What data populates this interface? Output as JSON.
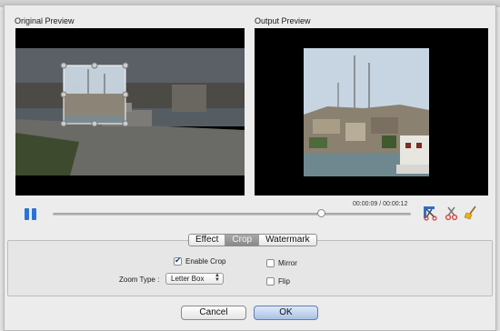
{
  "previews": {
    "original_label": "Original Preview",
    "output_label": "Output Preview"
  },
  "player": {
    "time": "00:00:09 / 00:00:12",
    "progress": 0.75
  },
  "tabs": [
    {
      "label": "Effect",
      "active": false
    },
    {
      "label": "Crop",
      "active": true
    },
    {
      "label": "Watermark",
      "active": false
    }
  ],
  "crop": {
    "enable_crop_label": "Enable Crop",
    "enable_crop_checked": true,
    "mirror_label": "Mirror",
    "mirror_checked": false,
    "flip_label": "Flip",
    "flip_checked": false,
    "zoom_type_label": "Zoom Type :",
    "zoom_type_value": "Letter Box"
  },
  "buttons": {
    "cancel": "Cancel",
    "ok": "OK"
  },
  "colors": {
    "accent_blue": "#2b74d6",
    "ok_button": "#a9c2e6",
    "preview_bg": "#000000"
  }
}
